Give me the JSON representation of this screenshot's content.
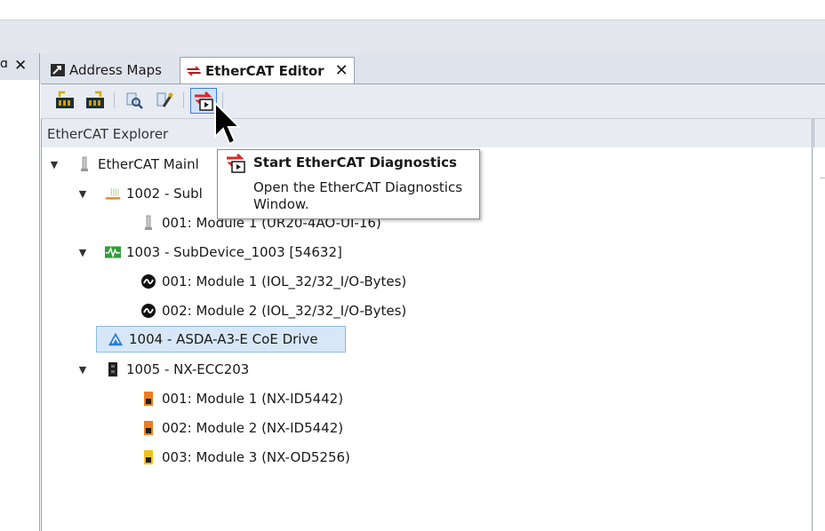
{
  "tabs": [
    {
      "label": "Address Maps",
      "icon": "address-map-icon"
    },
    {
      "label": "EtherCAT Editor",
      "icon": "ethercat-icon",
      "close": "✕"
    }
  ],
  "left_panel": {
    "pin_glyph": "ɑ",
    "close": "✕"
  },
  "toolbar": {
    "buttons": [
      "scan-upload-icon",
      "scan-download-icon",
      "search-device-icon",
      "config-tool-icon",
      "start-diagnostics-icon"
    ]
  },
  "explorer": {
    "title": "EtherCAT Explorer",
    "tree": [
      {
        "label": "EtherCAT Mainl",
        "icon": "mainbus-icon",
        "level": 0,
        "expanded": true
      },
      {
        "label": "1002 - Subl",
        "icon": "io-module-icon",
        "level": 1,
        "expanded": true
      },
      {
        "label": "001: Module 1 (UR20-4AO-UI-16)",
        "icon": "slice-icon",
        "level": 2
      },
      {
        "label": "1003 - SubDevice_1003 [54632]",
        "icon": "signal-green-icon",
        "level": 1,
        "expanded": true
      },
      {
        "label": "001: Module 1 (IOL_32/32_I/O-Bytes)",
        "icon": "iolink-icon",
        "level": 2
      },
      {
        "label": "002: Module 2 (IOL_32/32_I/O-Bytes)",
        "icon": "iolink-icon",
        "level": 2
      },
      {
        "label": "1004 - ASDA-A3-E CoE Drive",
        "icon": "drive-icon",
        "level": 1,
        "selected": true
      },
      {
        "label": "1005 - NX-ECC203",
        "icon": "coupler-icon",
        "level": 1,
        "expanded": true
      },
      {
        "label": "001: Module 1 (NX-ID5442)",
        "icon": "nx-orange-icon",
        "level": 2
      },
      {
        "label": "002: Module 2 (NX-ID5442)",
        "icon": "nx-orange-icon",
        "level": 2
      },
      {
        "label": "003: Module 3 (NX-OD5256)",
        "icon": "nx-yellow-icon",
        "level": 2
      }
    ]
  },
  "tooltip": {
    "title": "Start EtherCAT Diagnostics",
    "description": "Open the EtherCAT Diagnostics Window."
  },
  "colors": {
    "accent": "#3d7dd8",
    "selection": "#d7e7f7",
    "ethercat_red": "#e0262a"
  }
}
